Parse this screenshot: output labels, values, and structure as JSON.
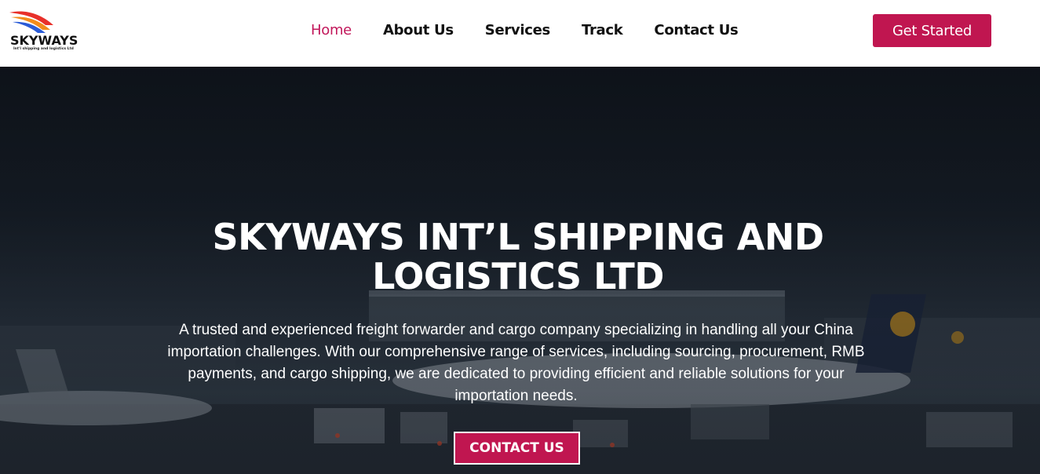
{
  "brand": {
    "name": "SKYWAYS",
    "tagline": "Int'l shipping and logistics Ltd"
  },
  "nav": {
    "items": [
      {
        "label": "Home",
        "active": true
      },
      {
        "label": "About Us",
        "active": false
      },
      {
        "label": "Services",
        "active": false
      },
      {
        "label": "Track",
        "active": false
      },
      {
        "label": "Contact Us",
        "active": false
      }
    ],
    "cta_label": "Get Started"
  },
  "hero": {
    "title": "SKYWAYS INT’L SHIPPING AND LOGISTICS LTD",
    "description": "A trusted and experienced freight forwarder and cargo company specializing in handling all your China importation challenges. With our comprehensive range of services, including sourcing, procurement, RMB payments, and cargo shipping, we are dedicated to providing efficient and reliable solutions for your importation needs.",
    "button_label": "CONTACT US",
    "background": "airport-apron-photo"
  },
  "colors": {
    "accent": "#c01650",
    "nav_active": "#c2185b",
    "header_bg": "#ffffff",
    "hero_text": "#ffffff"
  }
}
